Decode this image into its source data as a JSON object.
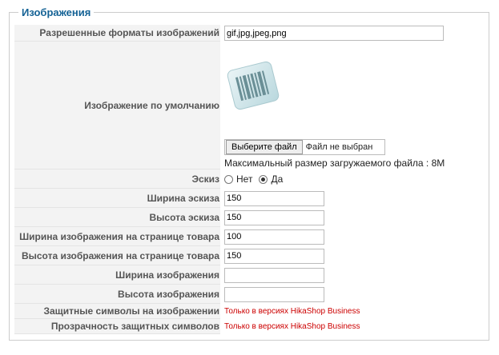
{
  "section_title": "Изображения",
  "fields": {
    "allowed_formats": {
      "label": "Разрешенные форматы изображений",
      "value": "gif,jpg,jpeg,png"
    },
    "default_image": {
      "label": "Изображение по умолчанию",
      "choose_file_button": "Выберите файл",
      "no_file_chosen": "Файл не выбран",
      "max_upload_size": "Максимальный размер загружаемого файла : 8M"
    },
    "thumbnail": {
      "label": "Эскиз",
      "option_no": "Нет",
      "option_yes": "Да",
      "selected": "Да"
    },
    "thumbnail_width": {
      "label": "Ширина эскиза",
      "value": "150"
    },
    "thumbnail_height": {
      "label": "Высота эскиза",
      "value": "150"
    },
    "product_image_width": {
      "label": "Ширина изображения на странице товара",
      "value": "100"
    },
    "product_image_height": {
      "label": "Высота изображения на странице товара",
      "value": "150"
    },
    "image_width": {
      "label": "Ширина изображения",
      "value": ""
    },
    "image_height": {
      "label": "Высота изображения",
      "value": ""
    },
    "watermark": {
      "label": "Защитные символы на изображении",
      "note": "Только в версиях HikaShop Business"
    },
    "watermark_opacity": {
      "label": "Прозрачность защитных символов",
      "note": "Только в версиях HikaShop Business"
    }
  },
  "colors": {
    "legend": "#146295",
    "label_bg": "#f3f3f3",
    "note": "#cc0000"
  },
  "icons": {
    "default_image": "barcode-icon"
  }
}
